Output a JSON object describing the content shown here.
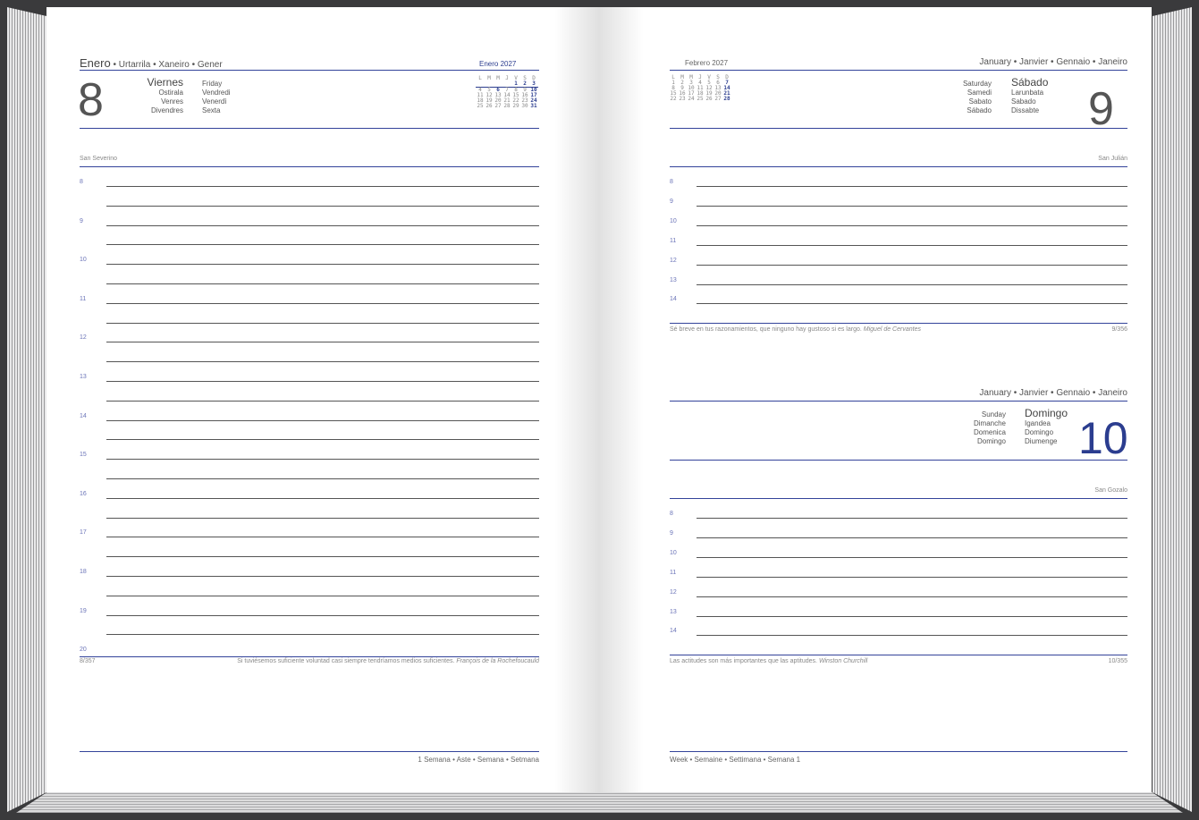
{
  "left": {
    "month_title": "Enero",
    "month_langs": " • Urtarrila • Xaneiro • Gener",
    "day_number": "8",
    "day_names_col1": [
      "Viernes",
      "Ostirala",
      "Venres",
      "Divendres"
    ],
    "day_names_col2": [
      "Friday",
      "Vendredi",
      "Venerdì",
      "Sexta"
    ],
    "mini_cal_title": "Enero 2027",
    "mini_cal_header": [
      "L",
      "M",
      "M",
      "J",
      "V",
      "S",
      "D"
    ],
    "mini_cal_rows": [
      [
        "",
        "",
        "",
        "",
        "1",
        "2",
        "3"
      ],
      [
        "4",
        "5",
        "6",
        "7",
        "8",
        "9",
        "10"
      ],
      [
        "11",
        "12",
        "13",
        "14",
        "15",
        "16",
        "17"
      ],
      [
        "18",
        "19",
        "20",
        "21",
        "22",
        "23",
        "24"
      ],
      [
        "25",
        "26",
        "27",
        "28",
        "29",
        "30",
        "31"
      ]
    ],
    "saint": "San Severino",
    "hours": [
      "8",
      "9",
      "10",
      "11",
      "12",
      "13",
      "14",
      "15",
      "16",
      "17",
      "18",
      "19",
      "20"
    ],
    "day_count": "8/357",
    "quote": "Si tuviésemos suficiente voluntad casi siempre tendríamos medios suficientes.",
    "quote_author": "François de la Rochefoucauld",
    "week_footer": "1 Semana • Aste • Semana • Setmana"
  },
  "right_top": {
    "mini_cal_title": "Febrero 2027",
    "mini_cal_header": [
      "L",
      "M",
      "M",
      "J",
      "V",
      "S",
      "D"
    ],
    "mini_cal_rows": [
      [
        "1",
        "2",
        "3",
        "4",
        "5",
        "6",
        "7"
      ],
      [
        "8",
        "9",
        "10",
        "11",
        "12",
        "13",
        "14"
      ],
      [
        "15",
        "16",
        "17",
        "18",
        "19",
        "20",
        "21"
      ],
      [
        "22",
        "23",
        "24",
        "25",
        "26",
        "27",
        "28"
      ]
    ],
    "month_langs": "January • Janvier • Gennaio • Janeiro",
    "day_names_col1": [
      "Saturday",
      "Samedi",
      "Sabato",
      "Sábado"
    ],
    "day_names_col2": [
      "Sábado",
      "Larunbata",
      "Sabado",
      "Dissabte"
    ],
    "day_number": "9",
    "saint": "San Julián",
    "hours": [
      "8",
      "9",
      "10",
      "11",
      "12",
      "13",
      "14"
    ],
    "quote": "Sé breve en tus razonamientos, que ninguno hay gustoso si es largo.",
    "quote_author": "Miguel de Cervantes",
    "day_count": "9/356"
  },
  "right_bottom": {
    "month_langs": "January • Janvier • Gennaio • Janeiro",
    "day_names_col1": [
      "Sunday",
      "Dimanche",
      "Domenica",
      "Domingo"
    ],
    "day_names_col2": [
      "Domingo",
      "Igandea",
      "Domingo",
      "Diumenge"
    ],
    "day_number": "10",
    "saint": "San Gozalo",
    "hours": [
      "8",
      "9",
      "10",
      "11",
      "12",
      "13",
      "14"
    ],
    "quote": "Las actitudes son más importantes que las aptitudes.",
    "quote_author": "Winston Churchill",
    "day_count": "10/355",
    "week_footer": "Week • Semaine • Settimana • Semana 1"
  },
  "colors": {
    "accent": "#2b3d8f",
    "cover": "#3a3a3c"
  }
}
